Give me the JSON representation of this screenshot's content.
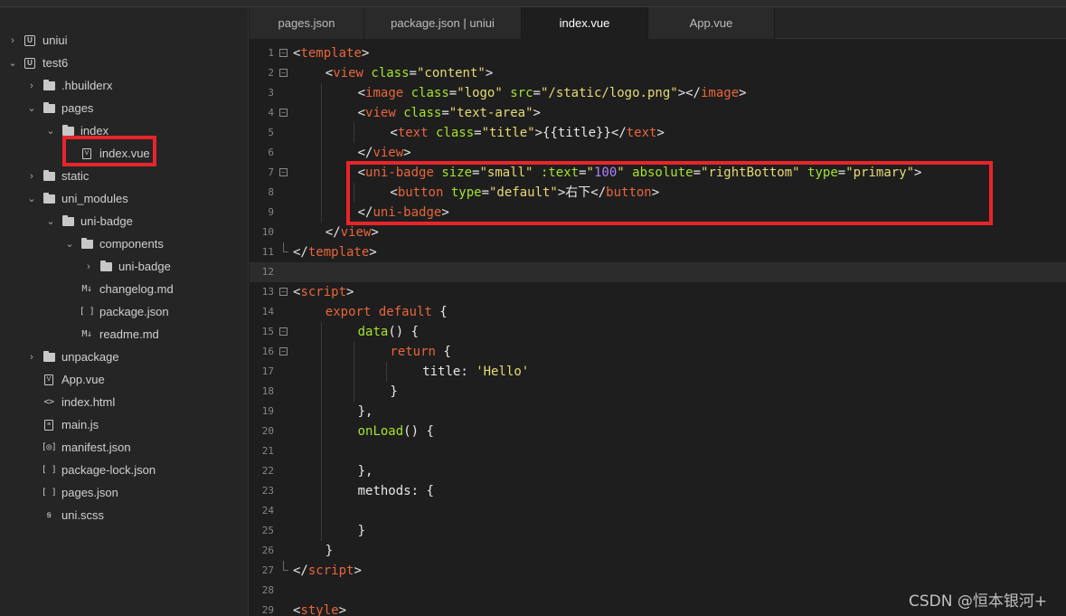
{
  "tabs": [
    {
      "label": "pages.json"
    },
    {
      "label": "package.json | uniui"
    },
    {
      "label": "index.vue"
    },
    {
      "label": "App.vue"
    }
  ],
  "tree": [
    {
      "label": "uniui",
      "chev": "›",
      "icon": "project-icon"
    },
    {
      "label": "test6",
      "chev": "⌄",
      "icon": "project-icon"
    },
    {
      "label": ".hbuilderx",
      "chev": "›",
      "icon": "folder-icon"
    },
    {
      "label": "pages",
      "chev": "⌄",
      "icon": "folder-icon"
    },
    {
      "label": "index",
      "chev": "⌄",
      "icon": "folder-icon"
    },
    {
      "label": "index.vue",
      "chev": "",
      "icon": "vue-file-icon"
    },
    {
      "label": "static",
      "chev": "›",
      "icon": "folder-icon"
    },
    {
      "label": "uni_modules",
      "chev": "⌄",
      "icon": "folder-icon"
    },
    {
      "label": "uni-badge",
      "chev": "⌄",
      "icon": "folder-icon"
    },
    {
      "label": "components",
      "chev": "⌄",
      "icon": "folder-icon"
    },
    {
      "label": "uni-badge",
      "chev": "›",
      "icon": "folder-icon"
    },
    {
      "label": "changelog.md",
      "chev": "",
      "icon": "markdown-icon"
    },
    {
      "label": "package.json",
      "chev": "",
      "icon": "json-icon"
    },
    {
      "label": "readme.md",
      "chev": "",
      "icon": "markdown-icon"
    },
    {
      "label": "unpackage",
      "chev": "›",
      "icon": "folder-icon"
    },
    {
      "label": "App.vue",
      "chev": "",
      "icon": "vue-file-icon"
    },
    {
      "label": "index.html",
      "chev": "",
      "icon": "html-icon"
    },
    {
      "label": "main.js",
      "chev": "",
      "icon": "js-file-icon"
    },
    {
      "label": "manifest.json",
      "chev": "",
      "icon": "manifest-icon"
    },
    {
      "label": "package-lock.json",
      "chev": "",
      "icon": "json-icon"
    },
    {
      "label": "pages.json",
      "chev": "",
      "icon": "json-icon"
    },
    {
      "label": "uni.scss",
      "chev": "",
      "icon": "scss-icon"
    }
  ],
  "code": {
    "line_numbers": [
      "1",
      "2",
      "3",
      "4",
      "5",
      "6",
      "7",
      "8",
      "9",
      "10",
      "11",
      "12",
      "13",
      "14",
      "15",
      "16",
      "17",
      "18",
      "19",
      "20",
      "21",
      "22",
      "23",
      "24",
      "25",
      "26",
      "27",
      "28",
      "29"
    ],
    "lines": [
      [
        [
          "br",
          "<"
        ],
        [
          "tag",
          "template"
        ],
        [
          "br",
          ">"
        ]
      ],
      [
        [
          "br",
          "<"
        ],
        [
          "tag",
          "view"
        ],
        [
          "txt",
          " "
        ],
        [
          "attr",
          "class"
        ],
        [
          "br",
          "="
        ],
        [
          "str",
          "\"content\""
        ],
        [
          "br",
          ">"
        ]
      ],
      [
        [
          "br",
          "<"
        ],
        [
          "tag",
          "image"
        ],
        [
          "txt",
          " "
        ],
        [
          "attr",
          "class"
        ],
        [
          "br",
          "="
        ],
        [
          "str",
          "\"logo\""
        ],
        [
          "txt",
          " "
        ],
        [
          "attr",
          "src"
        ],
        [
          "br",
          "="
        ],
        [
          "str",
          "\"/static/logo.png\""
        ],
        [
          "br",
          "></"
        ],
        [
          "tag",
          "image"
        ],
        [
          "br",
          ">"
        ]
      ],
      [
        [
          "br",
          "<"
        ],
        [
          "tag",
          "view"
        ],
        [
          "txt",
          " "
        ],
        [
          "attr",
          "class"
        ],
        [
          "br",
          "="
        ],
        [
          "str",
          "\"text-area\""
        ],
        [
          "br",
          ">"
        ]
      ],
      [
        [
          "br",
          "<"
        ],
        [
          "tag",
          "text"
        ],
        [
          "txt",
          " "
        ],
        [
          "attr",
          "class"
        ],
        [
          "br",
          "="
        ],
        [
          "str",
          "\"title\""
        ],
        [
          "br",
          ">"
        ],
        [
          "txt",
          "{{title}}"
        ],
        [
          "br",
          "</"
        ],
        [
          "tag",
          "text"
        ],
        [
          "br",
          ">"
        ]
      ],
      [
        [
          "br",
          "</"
        ],
        [
          "tag",
          "view"
        ],
        [
          "br",
          ">"
        ]
      ],
      [
        [
          "br",
          "<"
        ],
        [
          "tag",
          "uni-badge"
        ],
        [
          "txt",
          " "
        ],
        [
          "attr",
          "size"
        ],
        [
          "br",
          "="
        ],
        [
          "str",
          "\"small\""
        ],
        [
          "txt",
          " "
        ],
        [
          "attr",
          ":text"
        ],
        [
          "br",
          "="
        ],
        [
          "str",
          "\""
        ],
        [
          "num",
          "100"
        ],
        [
          "str",
          "\""
        ],
        [
          "txt",
          " "
        ],
        [
          "attr",
          "absolute"
        ],
        [
          "br",
          "="
        ],
        [
          "str",
          "\"rightBottom\""
        ],
        [
          "txt",
          " "
        ],
        [
          "attr",
          "type"
        ],
        [
          "br",
          "="
        ],
        [
          "str",
          "\"primary\""
        ],
        [
          "br",
          ">"
        ]
      ],
      [
        [
          "br",
          "<"
        ],
        [
          "tag",
          "button"
        ],
        [
          "txt",
          " "
        ],
        [
          "attr",
          "type"
        ],
        [
          "br",
          "="
        ],
        [
          "str",
          "\"default\""
        ],
        [
          "br",
          ">"
        ],
        [
          "txt",
          "右下"
        ],
        [
          "br",
          "</"
        ],
        [
          "tag",
          "button"
        ],
        [
          "br",
          ">"
        ]
      ],
      [
        [
          "br",
          "</"
        ],
        [
          "tag",
          "uni-badge"
        ],
        [
          "br",
          ">"
        ]
      ],
      [
        [
          "br",
          "</"
        ],
        [
          "tag",
          "view"
        ],
        [
          "br",
          ">"
        ]
      ],
      [
        [
          "br",
          "</"
        ],
        [
          "tag",
          "template"
        ],
        [
          "br",
          ">"
        ]
      ],
      [],
      [
        [
          "br",
          "<"
        ],
        [
          "tag",
          "script"
        ],
        [
          "br",
          ">"
        ]
      ],
      [
        [
          "kw",
          "export"
        ],
        [
          "txt",
          " "
        ],
        [
          "kw",
          "default"
        ],
        [
          "txt",
          " {"
        ]
      ],
      [
        [
          "fn",
          "data"
        ],
        [
          "txt",
          "() {"
        ]
      ],
      [
        [
          "kw",
          "return"
        ],
        [
          "txt",
          " {"
        ]
      ],
      [
        [
          "txt",
          "title: "
        ],
        [
          "str",
          "'Hello'"
        ]
      ],
      [
        [
          "txt",
          "}"
        ]
      ],
      [
        [
          "txt",
          "},"
        ]
      ],
      [
        [
          "fn",
          "onLoad"
        ],
        [
          "txt",
          "() {"
        ]
      ],
      [],
      [
        [
          "txt",
          "},"
        ]
      ],
      [
        [
          "txt",
          "methods: {"
        ]
      ],
      [],
      [
        [
          "txt",
          "}"
        ]
      ],
      [
        [
          "txt",
          "}"
        ]
      ],
      [
        [
          "br",
          "</"
        ],
        [
          "tag",
          "script"
        ],
        [
          "br",
          ">"
        ]
      ],
      [],
      [
        [
          "br",
          "<"
        ],
        [
          "tag",
          "style"
        ],
        [
          "br",
          ">"
        ]
      ]
    ]
  },
  "watermark": "CSDN @恒本银河+"
}
